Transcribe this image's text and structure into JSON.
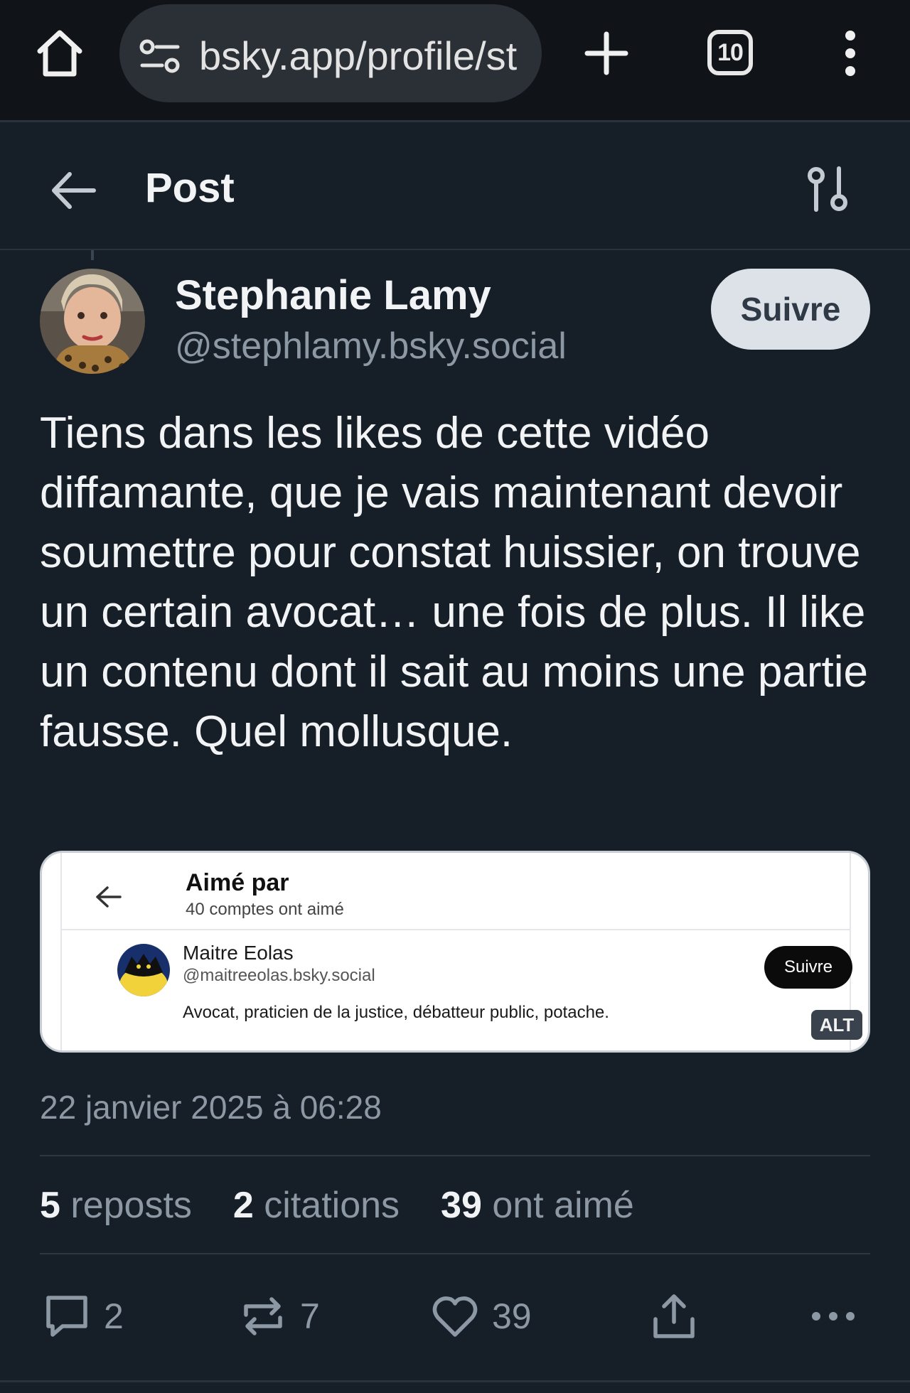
{
  "browser": {
    "url": "bsky.app/profile/st",
    "tab_count": "10",
    "icons": [
      "home-icon",
      "site-info-icon",
      "plus-icon",
      "tab-switcher-icon",
      "more-vertical-icon"
    ]
  },
  "header": {
    "title": "Post",
    "icons": [
      "arrow-left-icon",
      "filter-sliders-icon"
    ]
  },
  "post": {
    "author_name": "Stephanie Lamy",
    "author_handle": "@stephlamy.bsky.social",
    "follow_label": "Suivre",
    "text": "Tiens dans les likes de cette vidéo diffamante, que je vais maintenant devoir soumettre pour constat huissier, on trouve un certain avocat… une fois de plus. Il like un contenu dont il sait au moins une partie fausse. Quel mollusque.",
    "embed": {
      "title": "Aimé par",
      "subtitle": "40 comptes ont aimé",
      "user_name": "Maitre Eolas",
      "user_handle": "@maitreeolas.bsky.social",
      "user_bio": "Avocat, praticien de la justice, débatteur public, potache.",
      "follow_label": "Suivre",
      "alt_badge": "ALT"
    },
    "timestamp": "22 janvier 2025 à 06:28",
    "stats": {
      "reposts_count": "5",
      "reposts_label": "reposts",
      "quotes_count": "2",
      "quotes_label": "citations",
      "likes_count": "39",
      "likes_label": "ont aimé"
    },
    "actions": {
      "reply_count": "2",
      "repost_count": "7",
      "like_count": "39",
      "icons": [
        "reply-bubble-icon",
        "repost-icon",
        "heart-icon",
        "share-icon",
        "more-horizontal-icon"
      ]
    }
  },
  "colors": {
    "background": "#161e27",
    "browser_bar": "#101418",
    "url_pill": "#2b2f36",
    "primary_text": "#f1f3f5",
    "secondary_text": "#8d98a5",
    "follow_button": "#dde2e8"
  }
}
